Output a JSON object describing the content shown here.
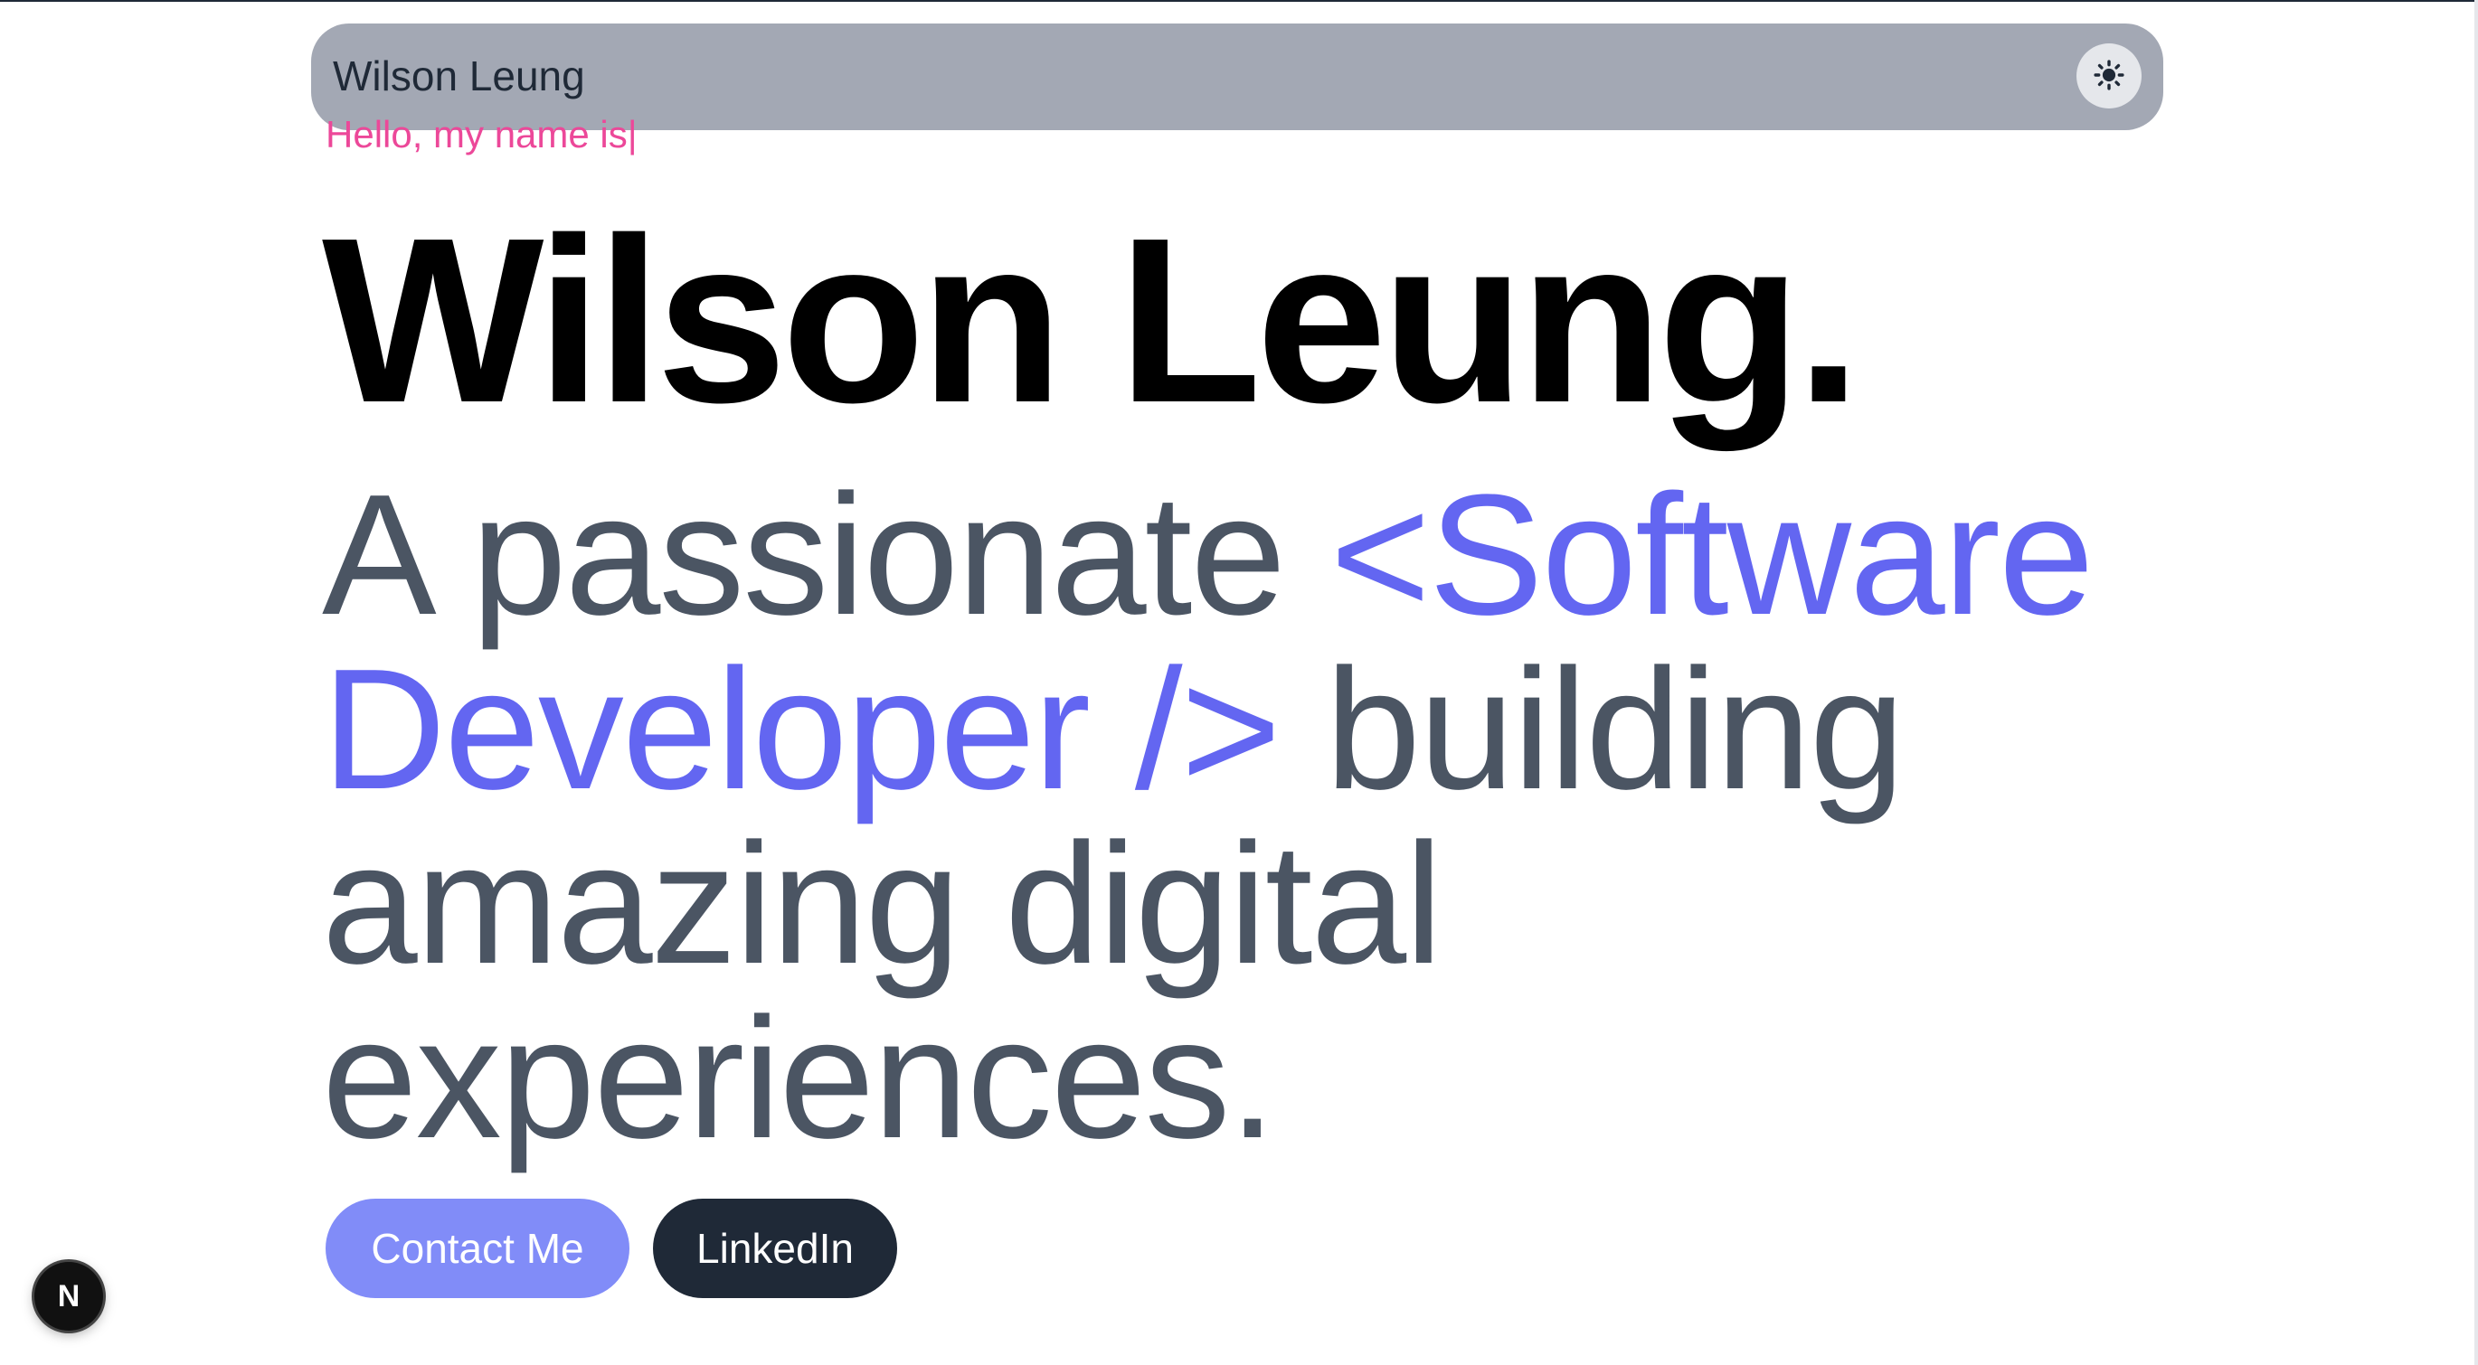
{
  "navbar": {
    "brand": "Wilson Leung",
    "theme_toggle_icon": "sun-icon"
  },
  "hero": {
    "greeting": "Hello, my name is",
    "caret": "|",
    "name": "Wilson Leung.",
    "tagline_prefix": "A passionate ",
    "tagline_role": "<Software Developer />",
    "tagline_suffix": " building amazing digital experiences."
  },
  "buttons": {
    "contact_label": "Contact Me",
    "linkedin_label": "LinkedIn"
  },
  "dev_badge": {
    "letter": "N",
    "icon": "nextjs-icon"
  },
  "colors": {
    "navbar_bg": "#a3a8b4",
    "greeting": "#ec4899",
    "accent": "#6366f1",
    "tagline": "#4b5563",
    "contact_button": "#818cf8",
    "linkedin_button": "#1f2937"
  }
}
